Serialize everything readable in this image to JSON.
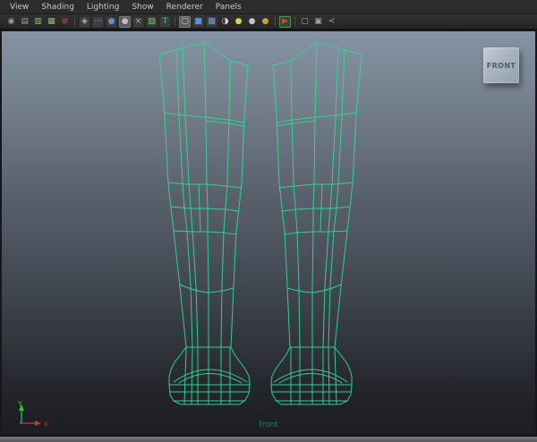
{
  "menu_bar": {
    "items": [
      "View",
      "Shading",
      "Lighting",
      "Show",
      "Renderer",
      "Panels"
    ]
  },
  "toolbar": {
    "groups": [
      [
        {
          "name": "select-camera-icon",
          "glyph": "◉",
          "color": "#9e9e9e",
          "plain": true
        },
        {
          "name": "camera-attributes-icon",
          "glyph": "▤",
          "color": "#9e9e9e",
          "plain": true
        },
        {
          "name": "bookmarks-icon",
          "glyph": "▥",
          "color": "#7ecb7e",
          "plain": true
        },
        {
          "name": "image-plane-icon",
          "glyph": "▦",
          "color": "#8fbf6f",
          "plain": true
        },
        {
          "name": "pan-zoom-icon",
          "glyph": "⊘",
          "color": "#d05548",
          "plain": true
        }
      ],
      [
        {
          "name": "perspective-layout-icon",
          "glyph": "◈",
          "color": "#b0b0b0"
        },
        {
          "name": "film-gate-icon",
          "glyph": "⋯",
          "color": "#b0b0b0"
        },
        {
          "name": "resolution-gate-icon",
          "glyph": "●",
          "color": "#5b8fd6"
        },
        {
          "name": "gate-mask-icon",
          "glyph": "●",
          "color": "#bdbdbd",
          "active": true
        },
        {
          "name": "field-chart-icon",
          "glyph": "×",
          "color": "#b0b0b0"
        },
        {
          "name": "safe-action-icon",
          "glyph": "▧",
          "color": "#6fbf6f"
        },
        {
          "name": "safe-title-icon",
          "glyph": "T",
          "color": "#6fbf6f"
        }
      ],
      [
        {
          "name": "wireframe-mode-icon",
          "glyph": "▢",
          "color": "#cfcfcf",
          "active": true
        },
        {
          "name": "smooth-shade-mode-icon",
          "glyph": "■",
          "color": "#5b8fd6"
        },
        {
          "name": "textured-mode-icon",
          "glyph": "▩",
          "color": "#6a9ad9"
        },
        {
          "name": "default-material-icon",
          "glyph": "◑",
          "color": "#d8d8d8",
          "plain": true
        },
        {
          "name": "all-lights-icon",
          "glyph": "●",
          "color": "#e3d435",
          "plain": true
        },
        {
          "name": "default-light-icon",
          "glyph": "●",
          "color": "#c4c4c4",
          "plain": true
        },
        {
          "name": "ambient-light-icon",
          "glyph": "●",
          "color": "#cf9a3a",
          "plain": true
        }
      ],
      [
        {
          "name": "isolate-select-icon",
          "glyph": "▶",
          "color": "#cc4437",
          "frame": "#4a9a4a"
        }
      ],
      [
        {
          "name": "xray-icon",
          "glyph": "▢",
          "color": "#a8a8a8",
          "plain": true
        },
        {
          "name": "xray-active-icon",
          "glyph": "▣",
          "color": "#a8a8a8",
          "plain": true
        },
        {
          "name": "plugin-shapes-icon",
          "glyph": "≺",
          "color": "#a8a8a8",
          "plain": true
        }
      ]
    ]
  },
  "viewport": {
    "view_plate_label": "FRONT",
    "camera_name_label": "front",
    "wireframe_color": "#31d894",
    "axis": {
      "y_label": "Y",
      "x_label": "x",
      "y_color": "#2fc92f",
      "x_color": "#cc3a28",
      "z_color": "#3a55cc"
    },
    "background": {
      "top": "#8494a4",
      "middle": "#4a515c",
      "bottom": "#1b1d21"
    }
  }
}
